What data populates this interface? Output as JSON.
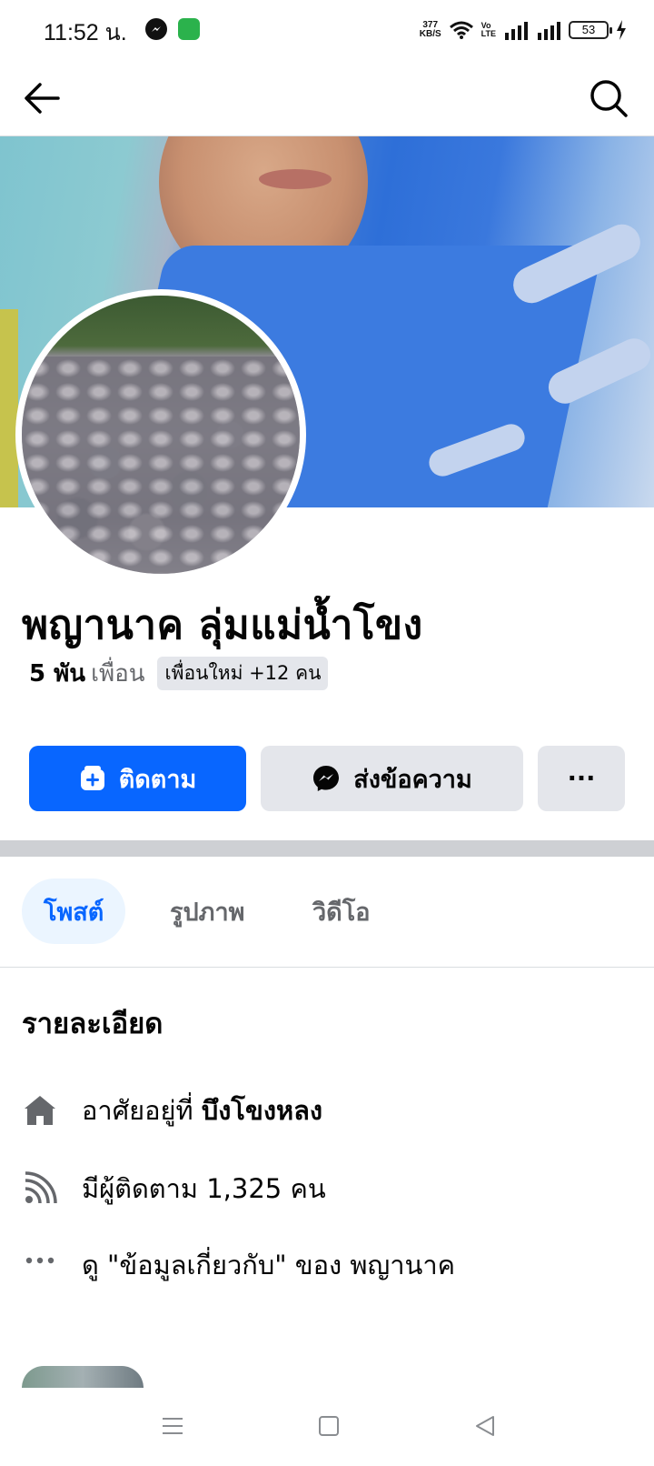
{
  "status_bar": {
    "time": "11:52 น.",
    "net_speed_value": "377",
    "net_speed_unit": "KB/S",
    "volte_top": "Vo",
    "volte_bottom": "LTE",
    "battery": "53"
  },
  "top_nav": {
    "back_icon": "arrow-left-icon",
    "search_icon": "search-icon"
  },
  "profile": {
    "name": "พญานาค ลุ่มแม่น้ำโขง",
    "friends_count": "5 พัน",
    "friends_word": "เพื่อน",
    "new_friends": "เพื่อนใหม่ +12 คน"
  },
  "actions": {
    "follow_label": "ติดตาม",
    "message_label": "ส่งข้อความ",
    "more_label": "···"
  },
  "tabs": [
    {
      "label": "โพสต์",
      "active": true
    },
    {
      "label": "รูปภาพ",
      "active": false
    },
    {
      "label": "วิดีโอ",
      "active": false
    }
  ],
  "details": {
    "heading": "รายละเอียด",
    "lives_prefix": "อาศัยอยู่ที่",
    "lives_place": "บึงโขงหลง",
    "followers": "มีผู้ติดตาม 1,325 คน",
    "about": "ดู \"ข้อมูลเกี่ยวกับ\" ของ พญานาค"
  },
  "colors": {
    "accent": "#0866ff",
    "tab_active_bg": "#ebf5ff",
    "button_gray": "#e4e6eb",
    "secondary_text": "#65676b"
  }
}
